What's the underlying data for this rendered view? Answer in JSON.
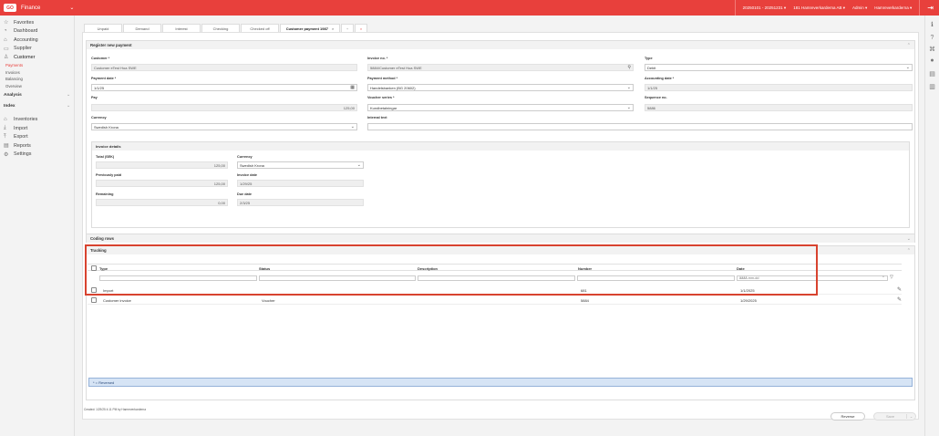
{
  "header": {
    "logo": "GO",
    "app_name": "Finance",
    "period": "20250101 - 20251231 ▾",
    "company": "181 Hamreverkarderna AB ▾",
    "user": "Admin ▾",
    "role": "Hamreverkarderna ▾",
    "exit_icon": "⇥"
  },
  "sidebar": {
    "favorites": "Favorites",
    "dashboard": "Dashboard",
    "accounting": "Accounting",
    "supplier": "Supplier",
    "customer": "Customer",
    "customer_items": [
      "Payments",
      "Invoices",
      "Balancing",
      "Overview"
    ],
    "analysis": "Analysis",
    "index": "Index",
    "inventories": "Inventories",
    "import": "Import",
    "export": "Export",
    "reports": "Reports",
    "settings": "Settings"
  },
  "tabs": [
    {
      "label": "Unpaid"
    },
    {
      "label": "Demand"
    },
    {
      "label": "Interest"
    },
    {
      "label": "Checking"
    },
    {
      "label": "Checked off"
    },
    {
      "label": "Customer payment 1987",
      "close": "×"
    },
    {
      "label": "+"
    },
    {
      "label": "×"
    }
  ],
  "register": {
    "title": "Register new payment",
    "customer_label": "Customer *",
    "customer_value": "Customer eTest Hoa SWE",
    "invoice_no_label": "Invoice no. *",
    "invoice_no_value": "5884/Customer eTest Hoa SWE",
    "type_label": "Type",
    "type_value": "Debit",
    "payment_date_label": "Payment date *",
    "payment_date_value": "1/1/25",
    "payment_method_label": "Payment method *",
    "payment_method_value": "Handelsbanken (BG 20602)",
    "accounting_date_label": "Accounting date *",
    "accounting_date_value": "1/1/25",
    "pay_label": "Pay",
    "pay_value": "125,00",
    "voucher_series_label": "Voucher series *",
    "voucher_series_value": "Kundbetalningar",
    "sequence_no_label": "Sequence no.",
    "sequence_no_value": "5886",
    "currency_label": "Currency",
    "currency_value": "Swedish Krona",
    "internal_text_label": "Internal text",
    "internal_text_value": ""
  },
  "invoice_details": {
    "title": "Invoice details",
    "total_label": "Total (SEK)",
    "total_value": "125,00",
    "currency_label": "Currency",
    "currency_value": "Swedish Krona",
    "prev_paid_label": "Previously paid",
    "prev_paid_value": "125,00",
    "invoice_date_label": "Invoice date",
    "invoice_date_value": "1/29/25",
    "remaining_label": "Remaining",
    "remaining_value": "0,00",
    "due_date_label": "Due date",
    "due_date_value": "2/3/25"
  },
  "coding_rows": {
    "title": "Coding rows"
  },
  "tracking": {
    "title": "Tracking",
    "columns": [
      "Type",
      "Status",
      "Description",
      "Number",
      "Date"
    ],
    "date_placeholder": "åååå-mm-dd",
    "rows": [
      {
        "type": "Import",
        "status": "",
        "description": "",
        "number": "681",
        "date": "1/1/2025"
      },
      {
        "type": "Customer invoice",
        "status": "Voucher",
        "description": "",
        "number": "5884",
        "date": "1/29/2025"
      }
    ],
    "legend": "* = Reversed"
  },
  "footer": {
    "created": "Created: 1/29/25 4:11 PM by Hamreverkarderna",
    "reverse_label": "Reverse",
    "save_label": "Save"
  }
}
